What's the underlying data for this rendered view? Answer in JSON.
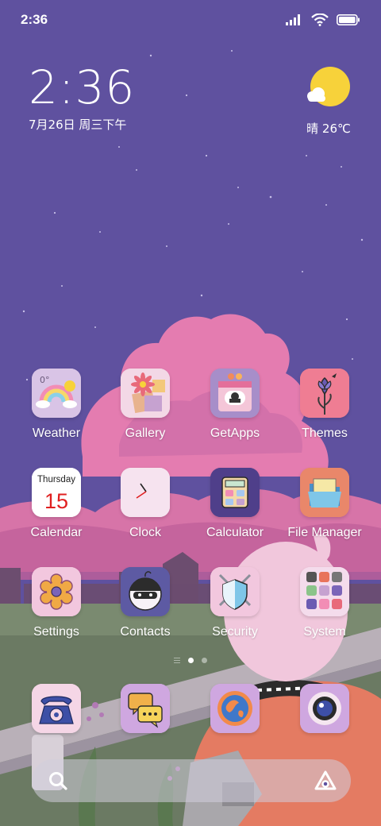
{
  "status_bar": {
    "time": "2:36",
    "icons": [
      "signal-icon",
      "wifi-icon",
      "battery-icon"
    ]
  },
  "clock_widget": {
    "time": "2:36",
    "date": "7月26日 周三下午"
  },
  "weather_widget": {
    "icon": "sun-cloud-icon",
    "text": "晴 26℃"
  },
  "apps": [
    {
      "name": "Weather",
      "icon": "weather-icon"
    },
    {
      "name": "Gallery",
      "icon": "gallery-icon"
    },
    {
      "name": "GetApps",
      "icon": "getapps-icon"
    },
    {
      "name": "Themes",
      "icon": "themes-icon"
    },
    {
      "name": "Calendar",
      "icon": "calendar-icon",
      "weekday": "Thursday",
      "day": "15"
    },
    {
      "name": "Clock",
      "icon": "clock-icon"
    },
    {
      "name": "Calculator",
      "icon": "calculator-icon"
    },
    {
      "name": "File Manager",
      "icon": "file-manager-icon"
    },
    {
      "name": "Settings",
      "icon": "settings-icon"
    },
    {
      "name": "Contacts",
      "icon": "contacts-icon"
    },
    {
      "name": "Security",
      "icon": "security-icon"
    },
    {
      "name": "System",
      "icon": "system-folder-icon"
    }
  ],
  "page_indicator": {
    "pages": 2,
    "current": 1
  },
  "dock": [
    {
      "icon": "phone-icon"
    },
    {
      "icon": "messages-icon"
    },
    {
      "icon": "browser-icon"
    },
    {
      "icon": "camera-icon"
    }
  ],
  "search_bar": {
    "left_icon": "search-icon",
    "right_icon": "assistant-icon"
  },
  "colors": {
    "sky": "#5f519f",
    "cloud": "#e47cb0",
    "ground": "#6b7a63",
    "sun": "#f7d23a"
  }
}
